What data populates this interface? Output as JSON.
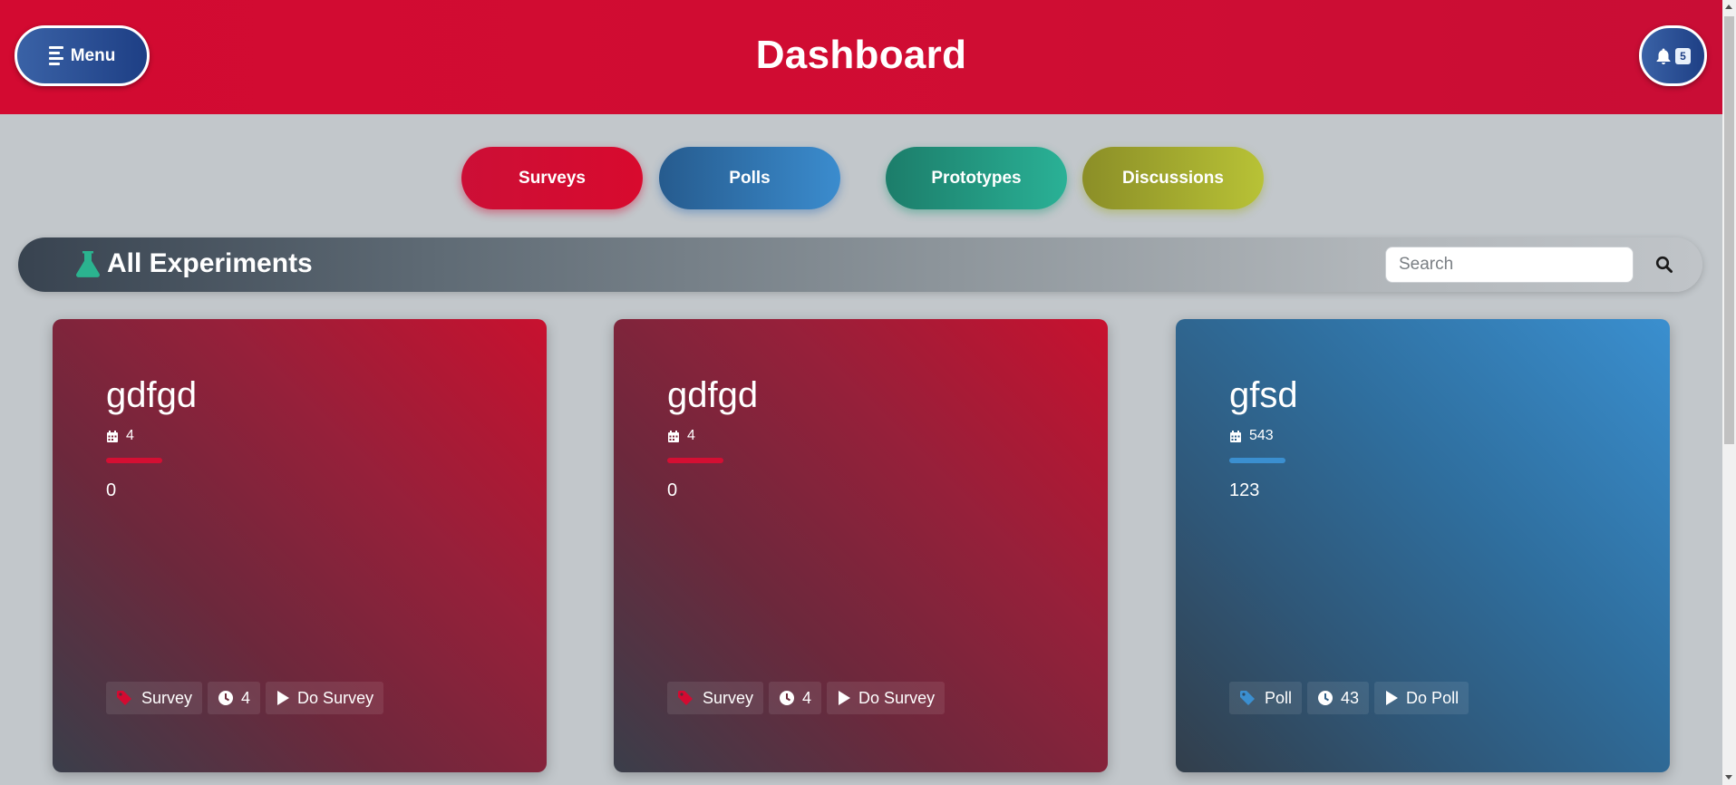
{
  "header": {
    "menu_label": "Menu",
    "title": "Dashboard",
    "notification_count": "5"
  },
  "tabs": [
    {
      "label": "Surveys",
      "color": "#d30a31"
    },
    {
      "label": "Polls",
      "color": "#3b8cce"
    },
    {
      "label": "Prototypes",
      "color": "#2ab196"
    },
    {
      "label": "Discussions",
      "color": "#b8c236"
    }
  ],
  "section": {
    "title": "All Experiments",
    "search_placeholder": "Search"
  },
  "cards": [
    {
      "title": "gdfgd",
      "date": "4",
      "description": "0",
      "type": "Survey",
      "duration": "4",
      "action": "Do Survey",
      "accent": "#d30a31"
    },
    {
      "title": "gdfgd",
      "date": "4",
      "description": "0",
      "type": "Survey",
      "duration": "4",
      "action": "Do Survey",
      "accent": "#d30a31"
    },
    {
      "title": "gfsd",
      "date": "543",
      "description": "123",
      "type": "Poll",
      "duration": "43",
      "action": "Do Poll",
      "accent": "#3b8fd0"
    }
  ],
  "icons": {
    "menu": "align-left-icon",
    "notifications": "bell-icon",
    "section": "flask-icon",
    "search": "search-icon",
    "date": "calendar-icon",
    "type": "tag-icon",
    "duration": "clock-icon",
    "action": "play-icon"
  }
}
